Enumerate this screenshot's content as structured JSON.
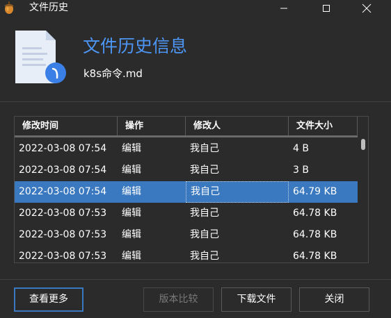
{
  "window": {
    "title": "文件历史"
  },
  "header": {
    "title": "文件历史信息",
    "filename": "k8s命令.md"
  },
  "table": {
    "columns": [
      "修改时间",
      "操作",
      "修改人",
      "文件大小"
    ],
    "rows": [
      {
        "time": "2022-03-08 07:54",
        "action": "编辑",
        "user": "我自己",
        "size": "4 B",
        "selected": false
      },
      {
        "time": "2022-03-08 07:54",
        "action": "编辑",
        "user": "我自己",
        "size": "3 B",
        "selected": false
      },
      {
        "time": "2022-03-08 07:54",
        "action": "编辑",
        "user": "我自己",
        "size": "64.79 KB",
        "selected": true
      },
      {
        "time": "2022-03-08 07:53",
        "action": "编辑",
        "user": "我自己",
        "size": "64.78 KB",
        "selected": false
      },
      {
        "time": "2022-03-08 07:53",
        "action": "编辑",
        "user": "我自己",
        "size": "64.78 KB",
        "selected": false
      },
      {
        "time": "2022-03-08 07:53",
        "action": "编辑",
        "user": "我自己",
        "size": "64.78 KB",
        "selected": false
      }
    ]
  },
  "footer": {
    "more_label": "查看更多",
    "compare_label": "版本比较",
    "download_label": "下载文件",
    "close_label": "关闭"
  },
  "colors": {
    "background": "#2b2b2b",
    "accent": "#4d96f5",
    "selection": "#3a78c0"
  },
  "icons": {
    "app": "acorn-icon",
    "file": "document-clock-icon"
  }
}
